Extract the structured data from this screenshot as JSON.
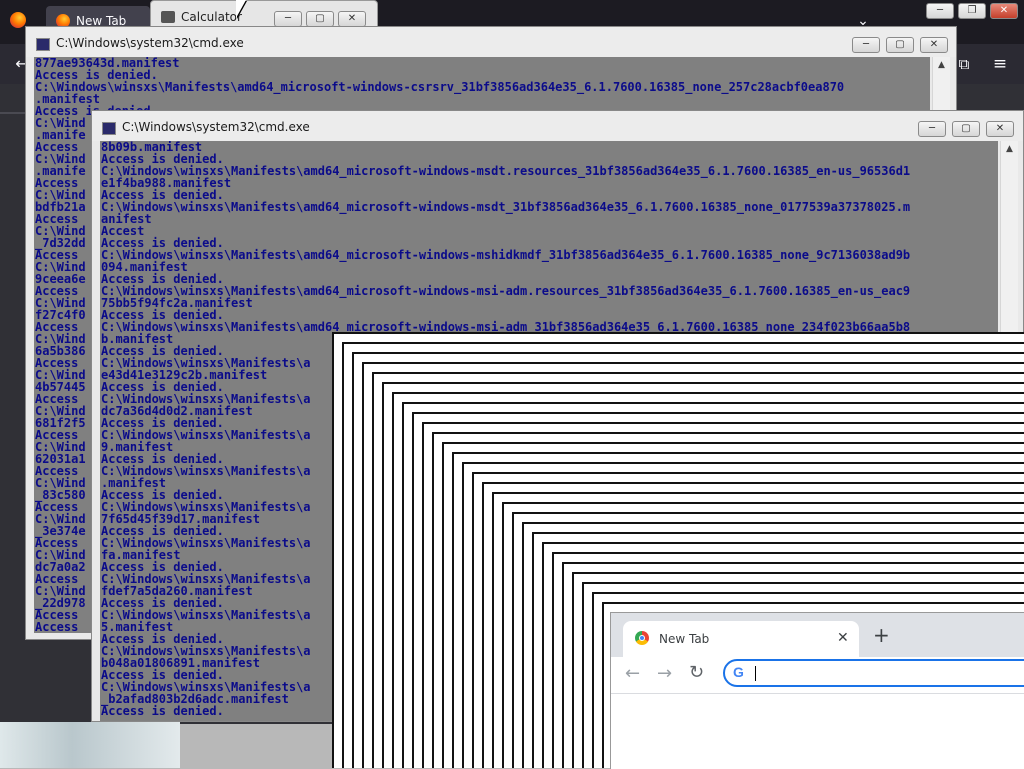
{
  "firefox": {
    "tab_label": "New Tab",
    "list_all_tabs": "⌄",
    "back": "←",
    "extensions": "⧉",
    "menu": "≡",
    "min": "─",
    "max": "❐",
    "close": "✕"
  },
  "calculator": {
    "title": "Calculator",
    "min": "─",
    "max": "▢",
    "close": "✕"
  },
  "cmd_back": {
    "title": "C:\\Windows\\system32\\cmd.exe",
    "min": "─",
    "max": "▢",
    "close": "✕",
    "lines": [
      "877ae93643d.manifest",
      "Access is denied.",
      "C:\\Windows\\winsxs\\Manifests\\amd64_microsoft-windows-csrsrv_31bf3856ad364e35_6.1.7600.16385_none_257c28acbf0ea870",
      ".manifest",
      "Access is denied.",
      "C:\\Wind",
      ".manife",
      "Access",
      "C:\\Wind",
      ".manife",
      "Access",
      "C:\\Wind",
      "bdfb21a",
      "Access",
      "C:\\Wind",
      "_7d32dd",
      "Access",
      "C:\\Wind",
      "9ceea6e",
      "Access",
      "C:\\Wind",
      "f27c4f0",
      "Access",
      "C:\\Wind",
      "6a5b386",
      "Access",
      "C:\\Wind",
      "4b57445",
      "Access",
      "C:\\Wind",
      "681f2f5",
      "Access",
      "C:\\Wind",
      "62031a1",
      "Access",
      "C:\\Wind",
      "_83c580",
      "Access",
      "C:\\Wind",
      "_3e374e",
      "Access",
      "C:\\Wind",
      "dc7a0a2",
      "Access",
      "C:\\Wind",
      "_22d978",
      "Access",
      "Access"
    ]
  },
  "cmd_front": {
    "title": "C:\\Windows\\system32\\cmd.exe",
    "min": "─",
    "max": "▢",
    "close": "✕",
    "lines": [
      "8b09b.manifest",
      "Access is denied.",
      "C:\\Windows\\winsxs\\Manifests\\amd64_microsoft-windows-msdt.resources_31bf3856ad364e35_6.1.7600.16385_en-us_96536d1",
      "e1f4ba988.manifest",
      "Access is denied.",
      "C:\\Windows\\winsxs\\Manifests\\amd64_microsoft-windows-msdt_31bf3856ad364e35_6.1.7600.16385_none_0177539a37378025.m",
      "anifest",
      "Accest",
      "Access is denied.",
      "C:\\Windows\\winsxs\\Manifests\\amd64_microsoft-windows-mshidkmdf_31bf3856ad364e35_6.1.7600.16385_none_9c7136038ad9b",
      "094.manifest",
      "Access is denied.",
      "C:\\Windows\\winsxs\\Manifests\\amd64_microsoft-windows-msi-adm.resources_31bf3856ad364e35_6.1.7600.16385_en-us_eac9",
      "75bb5f94fc2a.manifest",
      "Access is denied.",
      "C:\\Windows\\winsxs\\Manifests\\amd64_microsoft-windows-msi-adm_31bf3856ad364e35_6.1.7600.16385_none_234f023b66aa5b8",
      "b.manifest",
      "Access is denied.",
      "C:\\Windows\\winsxs\\Manifests\\a",
      "e43d41e3129c2b.manifest",
      "Access is denied.",
      "C:\\Windows\\winsxs\\Manifests\\a",
      "dc7a36d4d0d2.manifest",
      "Access is denied.",
      "C:\\Windows\\winsxs\\Manifests\\a",
      "9.manifest",
      "Access is denied.",
      "C:\\Windows\\winsxs\\Manifests\\a",
      ".manifest",
      "Access is denied.",
      "C:\\Windows\\winsxs\\Manifests\\a",
      "7f65d45f39d17.manifest",
      "Access is denied.",
      "C:\\Windows\\winsxs\\Manifests\\a",
      "fa.manifest",
      "Access is denied.",
      "C:\\Windows\\winsxs\\Manifests\\a",
      "fdef7a5da260.manifest",
      "Access is denied.",
      "C:\\Windows\\winsxs\\Manifests\\a",
      "5.manifest",
      "Access is denied.",
      "C:\\Windows\\winsxs\\Manifests\\a",
      "b048a01806891.manifest",
      "Access is denied.",
      "C:\\Windows\\winsxs\\Manifests\\a",
      "_b2afad803b2d6adc.manifest",
      "Access is denied."
    ]
  },
  "chrome": {
    "tab_label": "New Tab",
    "tab_close": "✕",
    "new_tab": "+",
    "back": "←",
    "forward": "→",
    "reload": "↻",
    "omnibox_logo": "G",
    "omnibox_value": ""
  },
  "colors": {
    "console_bg": "#808080",
    "console_text": "#0b0b8a",
    "firefox_toolbar": "#2b2a33",
    "omnibox_focus": "#1a73e8"
  }
}
